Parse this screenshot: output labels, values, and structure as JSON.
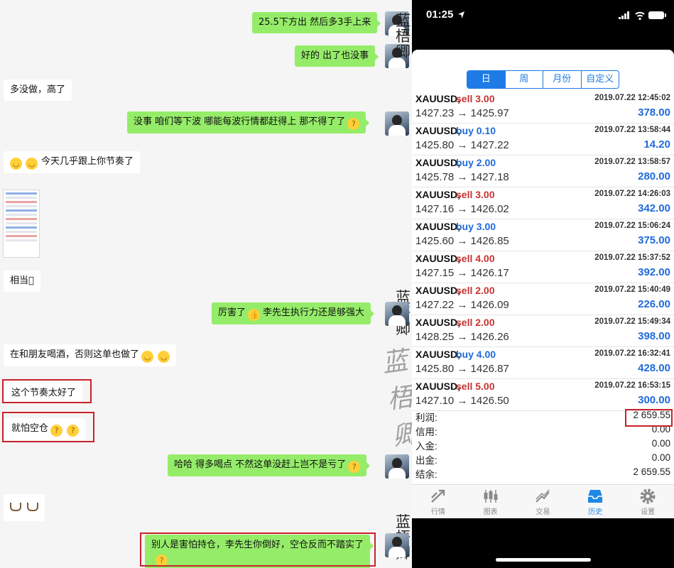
{
  "chat": {
    "messages": [
      {
        "text": "25.5下方出 然后多3手上来"
      },
      {
        "text": "好的 出了也没事"
      },
      {
        "text": "多没做，高了"
      },
      {
        "text": "没事 咱们等下波 哪能每波行情都赶得上 那不得了了"
      },
      {
        "text": "今天几乎跟上你节奏了"
      },
      {
        "text": "相当\u0000"
      },
      {
        "text": "厉害了"
      },
      {
        "text": "李先生执行力还是够强大"
      },
      {
        "text": "在和朋友喝酒，否则这单也做了"
      },
      {
        "text": "这个节奏太好了"
      },
      {
        "text": "就怕空仓"
      },
      {
        "text": "哈哈 得多喝点 不然这单没赶上岂不是亏了"
      },
      {
        "text": "别人是害怕持仓，李先生你倒好，空仓反而不踏实了"
      }
    ],
    "watermark": "蓝梧卿",
    "cursive_watermark": "蓝梧卿"
  },
  "phone": {
    "status": {
      "time": "01:25"
    },
    "segments": [
      "日",
      "周",
      "月份",
      "自定义"
    ],
    "active_segment": "日",
    "trades": [
      {
        "symbol": "XAUUSD,",
        "side": "sell 3.00",
        "type": "sell",
        "date": "2019.07.22 12:45:02",
        "prices": "1427.23 → 1425.97",
        "profit": "378.00"
      },
      {
        "symbol": "XAUUSD,",
        "side": "buy 0.10",
        "type": "buy",
        "date": "2019.07.22 13:58:44",
        "prices": "1425.80 → 1427.22",
        "profit": "14.20"
      },
      {
        "symbol": "XAUUSD,",
        "side": "buy 2.00",
        "type": "buy",
        "date": "2019.07.22 13:58:57",
        "prices": "1425.78 → 1427.18",
        "profit": "280.00"
      },
      {
        "symbol": "XAUUSD,",
        "side": "sell 3.00",
        "type": "sell",
        "date": "2019.07.22 14:26:03",
        "prices": "1427.16 → 1426.02",
        "profit": "342.00"
      },
      {
        "symbol": "XAUUSD,",
        "side": "buy 3.00",
        "type": "buy",
        "date": "2019.07.22 15:06:24",
        "prices": "1425.60 → 1426.85",
        "profit": "375.00"
      },
      {
        "symbol": "XAUUSD,",
        "side": "sell 4.00",
        "type": "sell",
        "date": "2019.07.22 15:37:52",
        "prices": "1427.15 → 1426.17",
        "profit": "392.00"
      },
      {
        "symbol": "XAUUSD,",
        "side": "sell 2.00",
        "type": "sell",
        "date": "2019.07.22 15:40:49",
        "prices": "1427.22 → 1426.09",
        "profit": "226.00"
      },
      {
        "symbol": "XAUUSD,",
        "side": "sell 2.00",
        "type": "sell",
        "date": "2019.07.22 15:49:34",
        "prices": "1428.25 → 1426.26",
        "profit": "398.00"
      },
      {
        "symbol": "XAUUSD,",
        "side": "buy 4.00",
        "type": "buy",
        "date": "2019.07.22 16:32:41",
        "prices": "1425.80 → 1426.87",
        "profit": "428.00"
      },
      {
        "symbol": "XAUUSD,",
        "side": "sell 5.00",
        "type": "sell",
        "date": "2019.07.22 16:53:15",
        "prices": "1427.10 → 1426.50",
        "profit": "300.00"
      }
    ],
    "summary": [
      {
        "label": "利润:",
        "value": "2 659.55"
      },
      {
        "label": "信用:",
        "value": "0.00"
      },
      {
        "label": "入金:",
        "value": "0.00"
      },
      {
        "label": "出金:",
        "value": "0.00"
      },
      {
        "label": "结余:",
        "value": "2 659.55"
      }
    ],
    "tabs": [
      {
        "label": "行情",
        "icon": "quotes-icon"
      },
      {
        "label": "图表",
        "icon": "chart-icon"
      },
      {
        "label": "交易",
        "icon": "trade-icon"
      },
      {
        "label": "历史",
        "icon": "history-icon"
      },
      {
        "label": "设置",
        "icon": "settings-icon"
      }
    ],
    "active_tab": "历史"
  },
  "colors": {
    "bubble_out": "#95ec69",
    "sell": "#c83232",
    "buy": "#1f6ad8",
    "accent": "#1e7be6",
    "highlight_box": "#c8222a"
  }
}
